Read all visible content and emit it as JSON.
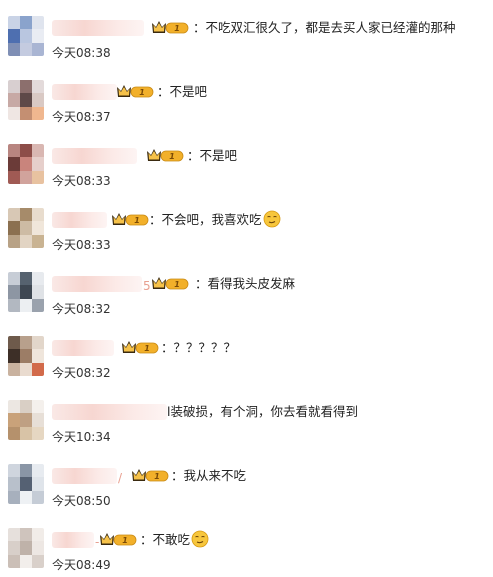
{
  "comments": [
    {
      "text": "：不吃双汇很久了，都是去买人家已经灌的那种",
      "time": "今天08:38",
      "name_tail": "",
      "emoji": false,
      "badge_level": "1"
    },
    {
      "text": "：不是吧",
      "time": "今天08:37",
      "name_tail": "",
      "emoji": false,
      "badge_level": "1"
    },
    {
      "text": "：不是吧",
      "time": "今天08:33",
      "name_tail": "",
      "emoji": false,
      "badge_level": "1"
    },
    {
      "text": "：不会吧，我喜欢吃",
      "time": "今天08:33",
      "name_tail": "",
      "emoji": true,
      "badge_level": "1"
    },
    {
      "text": "：看得我头皮发麻",
      "time": "今天08:32",
      "name_tail": "5",
      "emoji": false,
      "badge_level": "1"
    },
    {
      "text": "：？？？？？",
      "time": "今天08:32",
      "name_tail": "",
      "emoji": false,
      "badge_level": "1"
    },
    {
      "text": "l装破损，有个洞，你去看就看得到",
      "time": "今天10:34",
      "name_tail": "",
      "emoji": false,
      "badge_level": ""
    },
    {
      "text": "：我从来不吃",
      "time": "今天08:50",
      "name_tail": "/",
      "emoji": false,
      "badge_level": "1"
    },
    {
      "text": "：不敢吃",
      "time": "今天08:49",
      "name_tail": "-",
      "emoji": true,
      "badge_level": "1"
    }
  ],
  "colors": {
    "badge_gold": "#f2b02a",
    "crown_dark": "#3a2a10",
    "name_blur": "#f6d2cc"
  }
}
